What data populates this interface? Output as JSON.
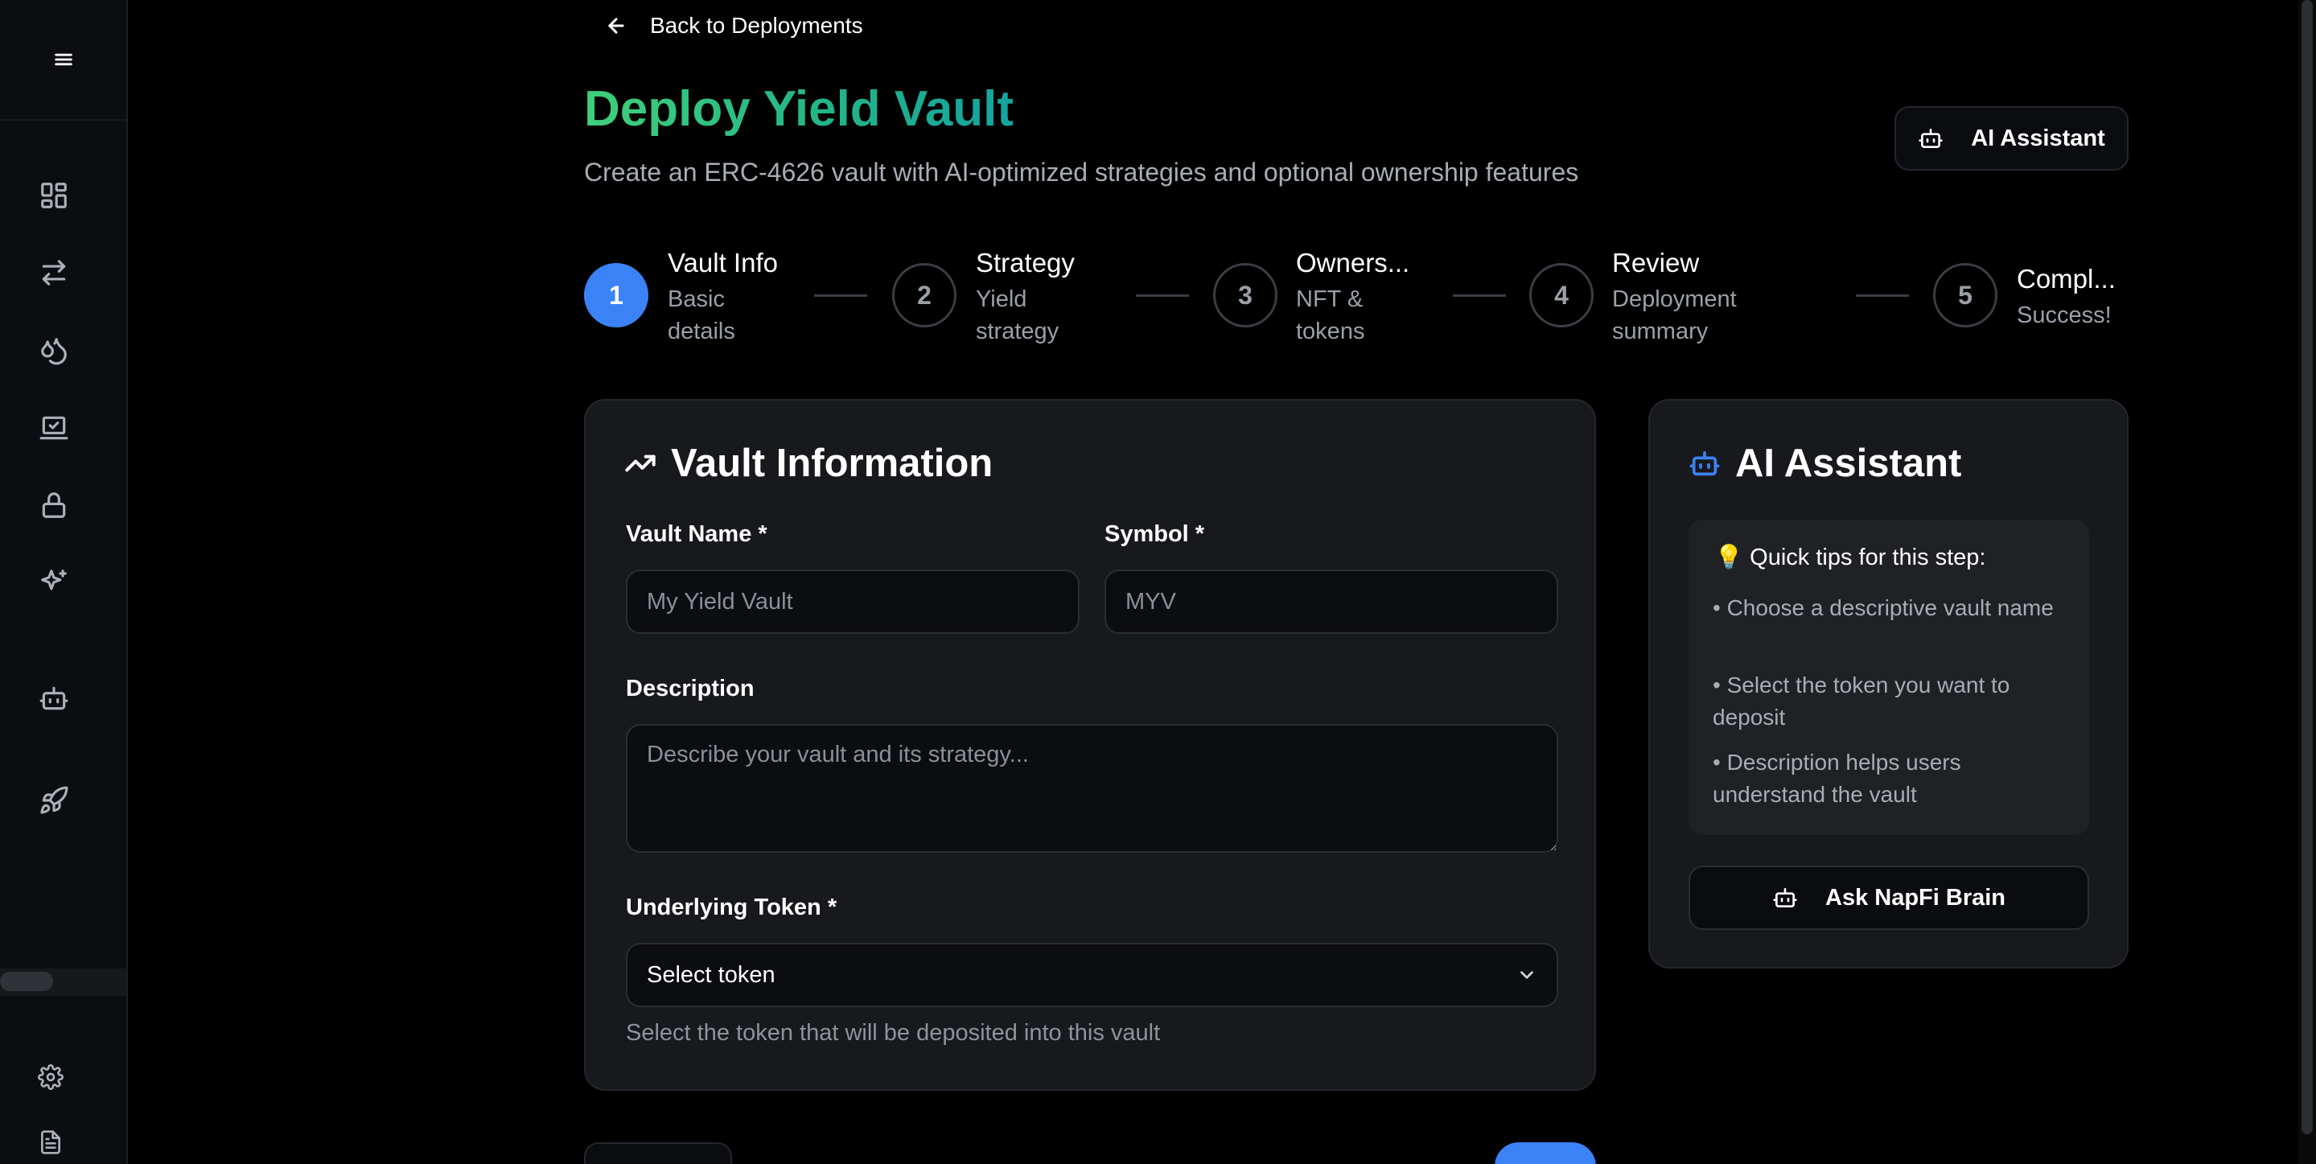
{
  "nav": {
    "back_label": "Back to Deployments"
  },
  "header": {
    "title": "Deploy Yield Vault",
    "subtitle": "Create an ERC-4626 vault with AI-optimized strategies and optional ownership features",
    "ai_button_label": "AI Assistant"
  },
  "sidebar": {
    "items": [
      {
        "icon": "dashboard-icon"
      },
      {
        "icon": "transfer-arrows-icon"
      },
      {
        "icon": "liquidity-drops-icon"
      },
      {
        "icon": "laptop-check-icon"
      },
      {
        "icon": "lock-icon"
      },
      {
        "icon": "sparkles-icon"
      },
      {
        "icon": "bot-icon"
      },
      {
        "icon": "rocket-icon"
      }
    ],
    "bottom_items": [
      {
        "icon": "gear-icon"
      },
      {
        "icon": "document-icon"
      }
    ]
  },
  "steps": [
    {
      "number": "1",
      "title": "Vault Info",
      "sub_line1": "Basic",
      "sub_line2": "details",
      "active": true
    },
    {
      "number": "2",
      "title": "Strategy",
      "sub_line1": "Yield",
      "sub_line2": "strategy",
      "active": false
    },
    {
      "number": "3",
      "title": "Owners...",
      "sub_line1": "NFT &",
      "sub_line2": "tokens",
      "active": false
    },
    {
      "number": "4",
      "title": "Review",
      "sub_line1": "Deployment",
      "sub_line2": "summary",
      "active": false
    },
    {
      "number": "5",
      "title": "Compl...",
      "sub_line1": "Success!",
      "sub_line2": "",
      "active": false
    }
  ],
  "form": {
    "title": "Vault Information",
    "vault_name_label": "Vault Name *",
    "vault_name_placeholder": "My Yield Vault",
    "symbol_label": "Symbol *",
    "symbol_placeholder": "MYV",
    "description_label": "Description",
    "description_placeholder": "Describe your vault and its strategy...",
    "token_label": "Underlying Token *",
    "token_selected": "Select token",
    "token_help": "Select the token that will be deposited into this vault"
  },
  "assistant": {
    "title": "AI Assistant",
    "tips_heading": "💡 Quick tips for this step:",
    "tips": [
      "• Choose a descriptive vault name",
      "• Select the token you want to deposit",
      "• Description helps users understand the vault"
    ],
    "ask_button_label": "Ask NapFi Brain"
  },
  "colors": {
    "accent": "#3b82f6",
    "title_gradient_start": "#3fd07a",
    "title_gradient_end": "#14a3a0",
    "assistant_icon": "#3b82f6"
  }
}
